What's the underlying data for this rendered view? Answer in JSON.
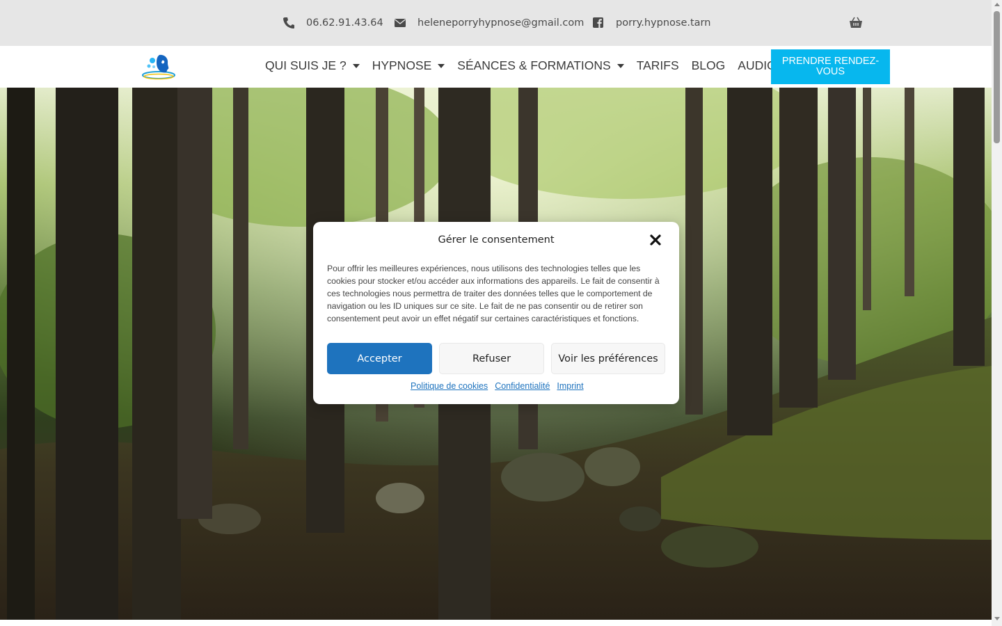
{
  "topbar": {
    "phone": "06.62.91.43.64",
    "email": "heleneporryhypnose@gmail.com",
    "facebook": "porry.hypnose.tarn"
  },
  "nav": {
    "items": [
      {
        "label": "QUI SUIS JE ?",
        "dropdown": true
      },
      {
        "label": "HYPNOSE",
        "dropdown": true
      },
      {
        "label": "SÉANCES & FORMATIONS",
        "dropdown": true
      },
      {
        "label": "TARIFS",
        "dropdown": false
      },
      {
        "label": "BLOG",
        "dropdown": false
      },
      {
        "label": "AUDIOS",
        "dropdown": false
      }
    ],
    "cta": "PRENDRE RENDEZ-VOUS"
  },
  "consent": {
    "title": "Gérer le consentement",
    "text": "Pour offrir les meilleures expériences, nous utilisons des technologies telles que les cookies pour stocker et/ou accéder aux informations des appareils. Le fait de consentir à ces technologies nous permettra de traiter des données telles que le comportement de navigation ou les ID uniques sur ce site. Le fait de ne pas consentir ou de retirer son consentement peut avoir un effet négatif sur certaines caractéristiques et fonctions.",
    "accept": "Accepter",
    "refuse": "Refuser",
    "preferences": "Voir les préférences",
    "links": [
      "Politique de cookies",
      "Confidentialité",
      "Imprint"
    ]
  },
  "colors": {
    "topbar_bg": "#e6e6e6",
    "cta_bg": "#07b7ee",
    "accept_bg": "#1e73be",
    "link": "#1e73be"
  },
  "icons": [
    "phone-icon",
    "envelope-icon",
    "facebook-icon",
    "cart-icon",
    "close-icon",
    "chevron-down-icon"
  ]
}
